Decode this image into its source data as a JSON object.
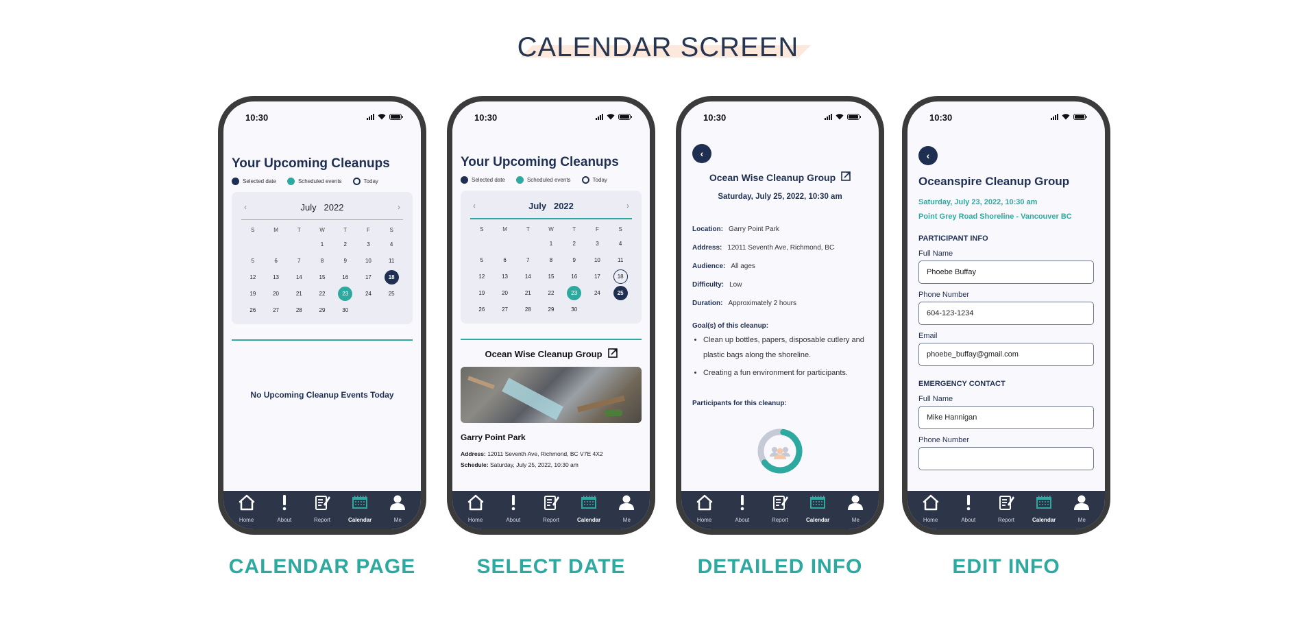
{
  "title": "CALENDAR SCREEN",
  "status_time": "10:30",
  "colors": {
    "navy": "#1f2f52",
    "teal": "#2ea99f",
    "navbar": "#2d3549",
    "peach": "#fde9dc"
  },
  "nav": [
    {
      "label": "Home",
      "icon": "home-icon"
    },
    {
      "label": "About",
      "icon": "exclamation-icon"
    },
    {
      "label": "Report",
      "icon": "report-icon"
    },
    {
      "label": "Calendar",
      "icon": "calendar-icon",
      "active": true
    },
    {
      "label": "Me",
      "icon": "user-icon"
    }
  ],
  "legend": {
    "selected": "Selected date",
    "scheduled": "Scheduled events",
    "today": "Today"
  },
  "calendar": {
    "month": "July",
    "year": "2022",
    "prev": "‹",
    "next": "›",
    "dow": [
      "S",
      "M",
      "T",
      "W",
      "T",
      "F",
      "S"
    ],
    "first_weekday": 3,
    "days": 30
  },
  "screens": [
    {
      "caption": "CALENDAR PAGE",
      "heading": "Your Upcoming Cleanups",
      "selected_day": 18,
      "scheduled_days": [
        23
      ],
      "today_day": null,
      "empty_message": "No Upcoming Cleanup Events Today"
    },
    {
      "caption": "SELECT DATE",
      "heading": "Your Upcoming Cleanups",
      "selected_day": 25,
      "scheduled_days": [
        23
      ],
      "today_day": 18,
      "event": {
        "group": "Ocean Wise Cleanup Group",
        "location": "Garry Point Park",
        "address_label": "Address:",
        "address": "12011 Seventh Ave, Richmond, BC V7E 4X2",
        "schedule_label": "Schedule:",
        "schedule": "Saturday, July 25, 2022, 10:30 am"
      }
    },
    {
      "caption": "DETAILED INFO",
      "group": "Ocean Wise Cleanup Group",
      "datetime": "Saturday, July 25, 2022, 10:30 am",
      "details": [
        {
          "label": "Location:",
          "value": "Garry Point Park"
        },
        {
          "label": "Address:",
          "value": "12011 Seventh Ave, Richmond, BC"
        },
        {
          "label": "Audience:",
          "value": "All ages"
        },
        {
          "label": "Difficulty:",
          "value": "Low"
        },
        {
          "label": "Duration:",
          "value": "Approximately 2 hours"
        }
      ],
      "goals_label": "Goal(s) of this cleanup:",
      "goals": [
        "Clean up bottles, papers, disposable cutlery and plastic bags along the shoreline.",
        "Creating a fun environment for participants."
      ],
      "participants_label": "Participants for this cleanup:",
      "participants_fill_fraction": 0.62
    },
    {
      "caption": "EDIT INFO",
      "group": "Oceanspire Cleanup Group",
      "datetime": "Saturday, July 23, 2022, 10:30 am",
      "place": "Point Grey Road Shoreline - Vancouver BC",
      "participant_section": "PARTICIPANT INFO",
      "participant_fields": [
        {
          "label": "Full Name",
          "value": "Phoebe Buffay"
        },
        {
          "label": "Phone Number",
          "value": "604-123-1234"
        },
        {
          "label": "Email",
          "value": "phoebe_buffay@gmail.com"
        }
      ],
      "emergency_section": "EMERGENCY CONTACT",
      "emergency_fields": [
        {
          "label": "Full Name",
          "value": "Mike Hannigan"
        },
        {
          "label": "Phone Number",
          "value": ""
        }
      ]
    }
  ]
}
